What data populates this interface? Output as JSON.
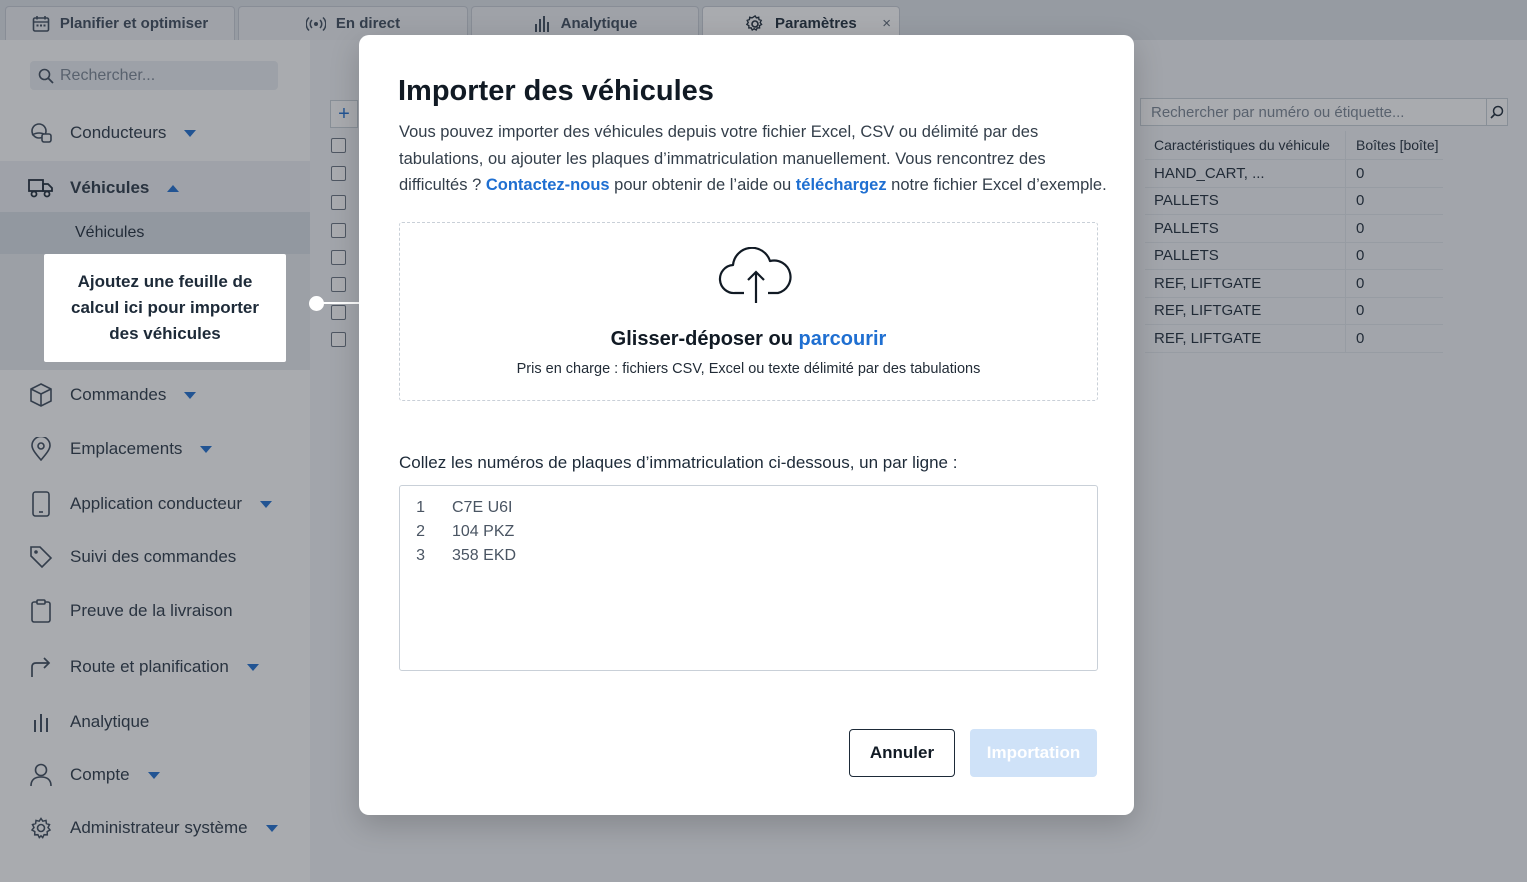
{
  "tabs": [
    {
      "label": "Planifier et optimiser",
      "icon": "calendar-icon"
    },
    {
      "label": "En direct",
      "icon": "broadcast-icon"
    },
    {
      "label": "Analytique",
      "icon": "bar-chart-icon"
    },
    {
      "label": "Paramètres",
      "icon": "gear-icon",
      "close": "×"
    }
  ],
  "sidebar": {
    "search_placeholder": "Rechercher...",
    "items": [
      {
        "label": "Conducteurs",
        "icon": "drivers-icon"
      },
      {
        "label": "Véhicules",
        "icon": "truck-icon"
      },
      {
        "label": "Commandes",
        "icon": "box-icon"
      },
      {
        "label": "Emplacements",
        "icon": "location-pin-icon"
      },
      {
        "label": "Application conducteur",
        "icon": "phone-icon"
      },
      {
        "label": "Suivi des commandes",
        "icon": "tag-icon"
      },
      {
        "label": "Preuve de la livraison",
        "icon": "clipboard-icon"
      },
      {
        "label": "Route et planification",
        "icon": "route-arrow-icon"
      },
      {
        "label": "Analytique",
        "icon": "bar-chart-icon"
      },
      {
        "label": "Compte",
        "icon": "user-icon"
      },
      {
        "label": "Administrateur système",
        "icon": "gear-icon"
      }
    ],
    "subitem": "Véhicules"
  },
  "tooltip": {
    "text": "Ajoutez une feuille de calcul ici pour importer des véhicules"
  },
  "background_table": {
    "search_placeholder": "Rechercher par numéro ou étiquette...",
    "plus": "+",
    "headers": [
      "Caractéristiques du véhicule",
      "Boîtes [boîte]"
    ],
    "rows": [
      [
        "HAND_CART, ...",
        "0"
      ],
      [
        "PALLETS",
        "0"
      ],
      [
        "PALLETS",
        "0"
      ],
      [
        "PALLETS",
        "0"
      ],
      [
        "REF, LIFTGATE",
        "0"
      ],
      [
        "REF, LIFTGATE",
        "0"
      ],
      [
        "REF, LIFTGATE",
        "0"
      ]
    ]
  },
  "modal": {
    "title": "Importer des véhicules",
    "desc_1": "Vous pouvez importer des véhicules depuis votre fichier Excel, CSV ou délimité par des tabulations, ou ajouter les plaques d’immatriculation manuellement. Vous rencontrez des difficultés ? ",
    "contact_link": "Contactez-nous",
    "desc_2": " pour obtenir de l’aide ou ",
    "download_link": "téléchargez",
    "desc_3": " notre fichier Excel d’exemple.",
    "dropzone_title": "Glisser-déposer ou ",
    "browse_link": "parcourir",
    "dropzone_sub": "Pris en charge : fichiers CSV, Excel ou texte délimité par des tabulations",
    "paste_label": "Collez les numéros de plaques d’immatriculation ci-dessous, un par ligne :",
    "plates": [
      {
        "line": "1",
        "value": "C7E U6I"
      },
      {
        "line": "2",
        "value": "104 PKZ"
      },
      {
        "line": "3",
        "value": "358 EKD"
      }
    ],
    "cancel_label": "Annuler",
    "import_label": "Importation"
  },
  "colors": {
    "accent": "#1f6fd1",
    "import_disabled": "#cfe2f8"
  }
}
